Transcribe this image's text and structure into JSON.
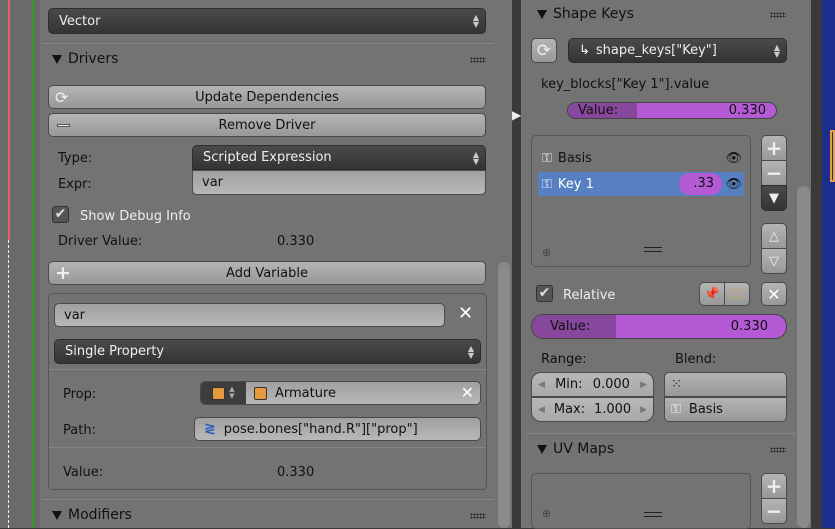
{
  "colors": {
    "panel": "#737373",
    "selected_row": "#5680c2",
    "slider_fill": "#86479c",
    "slider_bg": "#b35ad4",
    "viewport": "#1e2e8c"
  },
  "left": {
    "vector_dropdown": "Vector",
    "drivers": {
      "title": "Drivers",
      "update_dependencies": "Update Dependencies",
      "remove_driver": "Remove Driver",
      "type_label": "Type:",
      "type_value": "Scripted Expression",
      "expr_label": "Expr:",
      "expr_value": "var",
      "show_debug_label": "Show Debug Info",
      "show_debug_checked": true,
      "driver_value_label": "Driver Value:",
      "driver_value": "0.330",
      "add_variable": "Add Variable",
      "variable": {
        "name": "var",
        "type": "Single Property",
        "prop_label": "Prop:",
        "prop_value": "Armature",
        "path_label": "Path:",
        "path_value": "pose.bones[\"hand.R\"][\"prop\"]",
        "value_label": "Value:",
        "value": "0.330"
      }
    },
    "modifiers_title": "Modifiers"
  },
  "right": {
    "shape_keys": {
      "title": "Shape Keys",
      "datablock": "shape_keys[\"Key\"]",
      "path_text": "key_blocks[\"Key 1\"].value",
      "top_slider": {
        "label": "Value:",
        "value": "0.330",
        "fraction": 0.33
      },
      "items": [
        {
          "name": "Basis",
          "value": "",
          "selected": false
        },
        {
          "name": "Key 1",
          "value": ".33",
          "selected": true
        }
      ],
      "relative_label": "Relative",
      "relative_checked": true,
      "value_slider": {
        "label": "Value:",
        "value": "0.330",
        "fraction": 0.33
      },
      "range_label": "Range:",
      "min_label": "Min:",
      "min_value": "0.000",
      "max_label": "Max:",
      "max_value": "1.000",
      "blend_label": "Blend:",
      "blend_key": "Basis"
    },
    "uv_maps_title": "UV Maps"
  }
}
